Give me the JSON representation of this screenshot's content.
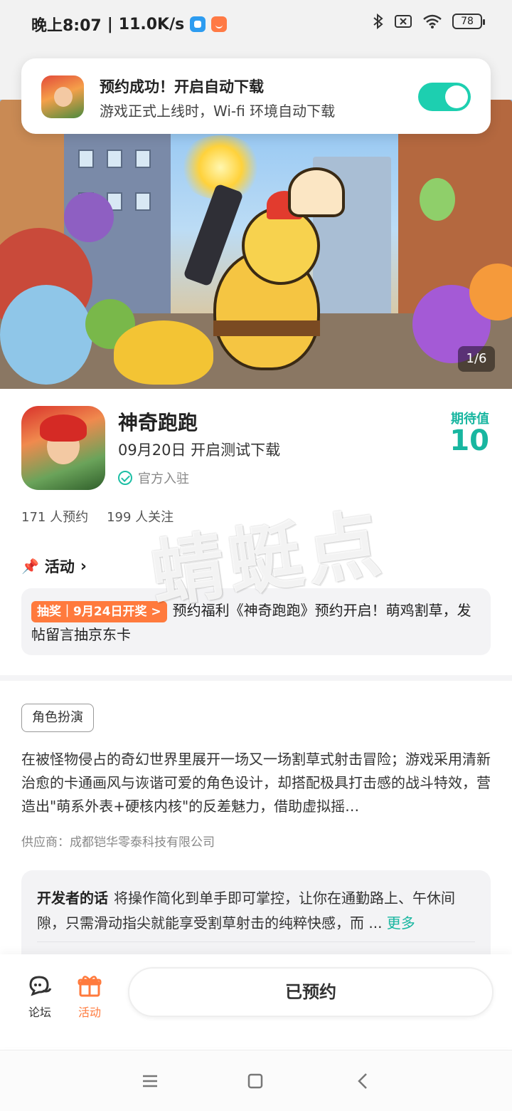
{
  "status_bar": {
    "time": "晚上8:07",
    "speed": "11.0K/s",
    "battery": "78"
  },
  "toast": {
    "title": "预约成功！开启自动下载",
    "subtitle": "游戏正式上线时，Wi-fi 环境自动下载",
    "toggle_on": true
  },
  "banner": {
    "counter": "1/6"
  },
  "app": {
    "name": "神奇跑跑",
    "date_text": "09月20日 开启测试下载",
    "official": "官方入驻",
    "expect_label": "期待值",
    "expect_value": "10",
    "reserve_count": "171 人预约",
    "follow_count": "199 人关注"
  },
  "activity": {
    "heading": "活动",
    "tag": "抽奖｜9月24日开奖 >",
    "text": "预约福利《神奇跑跑》预约开启！萌鸡割草，发帖留言抽京东卡"
  },
  "watermark": "蜻蜓点",
  "details": {
    "genre": "角色扮演",
    "description": "在被怪物侵占的奇幻世界里展开一场又一场割草式射击冒险；游戏采用清新治愈的卡通画风与诙谐可爱的角色设计，却搭配极具打击感的战斗特效，营造出\"萌系外表+硬核内核\"的反差魅力，借助虚拟摇…",
    "supplier": "供应商：成都铠华零泰科技有限公司"
  },
  "developer": {
    "label": "开发者的话",
    "text": "将操作简化到单手即可掌控，让你在通勤路上、午休间隙，只需滑动指尖就能享受割草射击的纯粹快感，而 ...",
    "more": "更多"
  },
  "bottom_bar": {
    "forum_label": "论坛",
    "activity_label": "活动",
    "reserved_label": "已预约"
  },
  "colors": {
    "accent": "#18b6a0",
    "orange": "#ff7a3d",
    "toggle": "#1dcfb0"
  }
}
